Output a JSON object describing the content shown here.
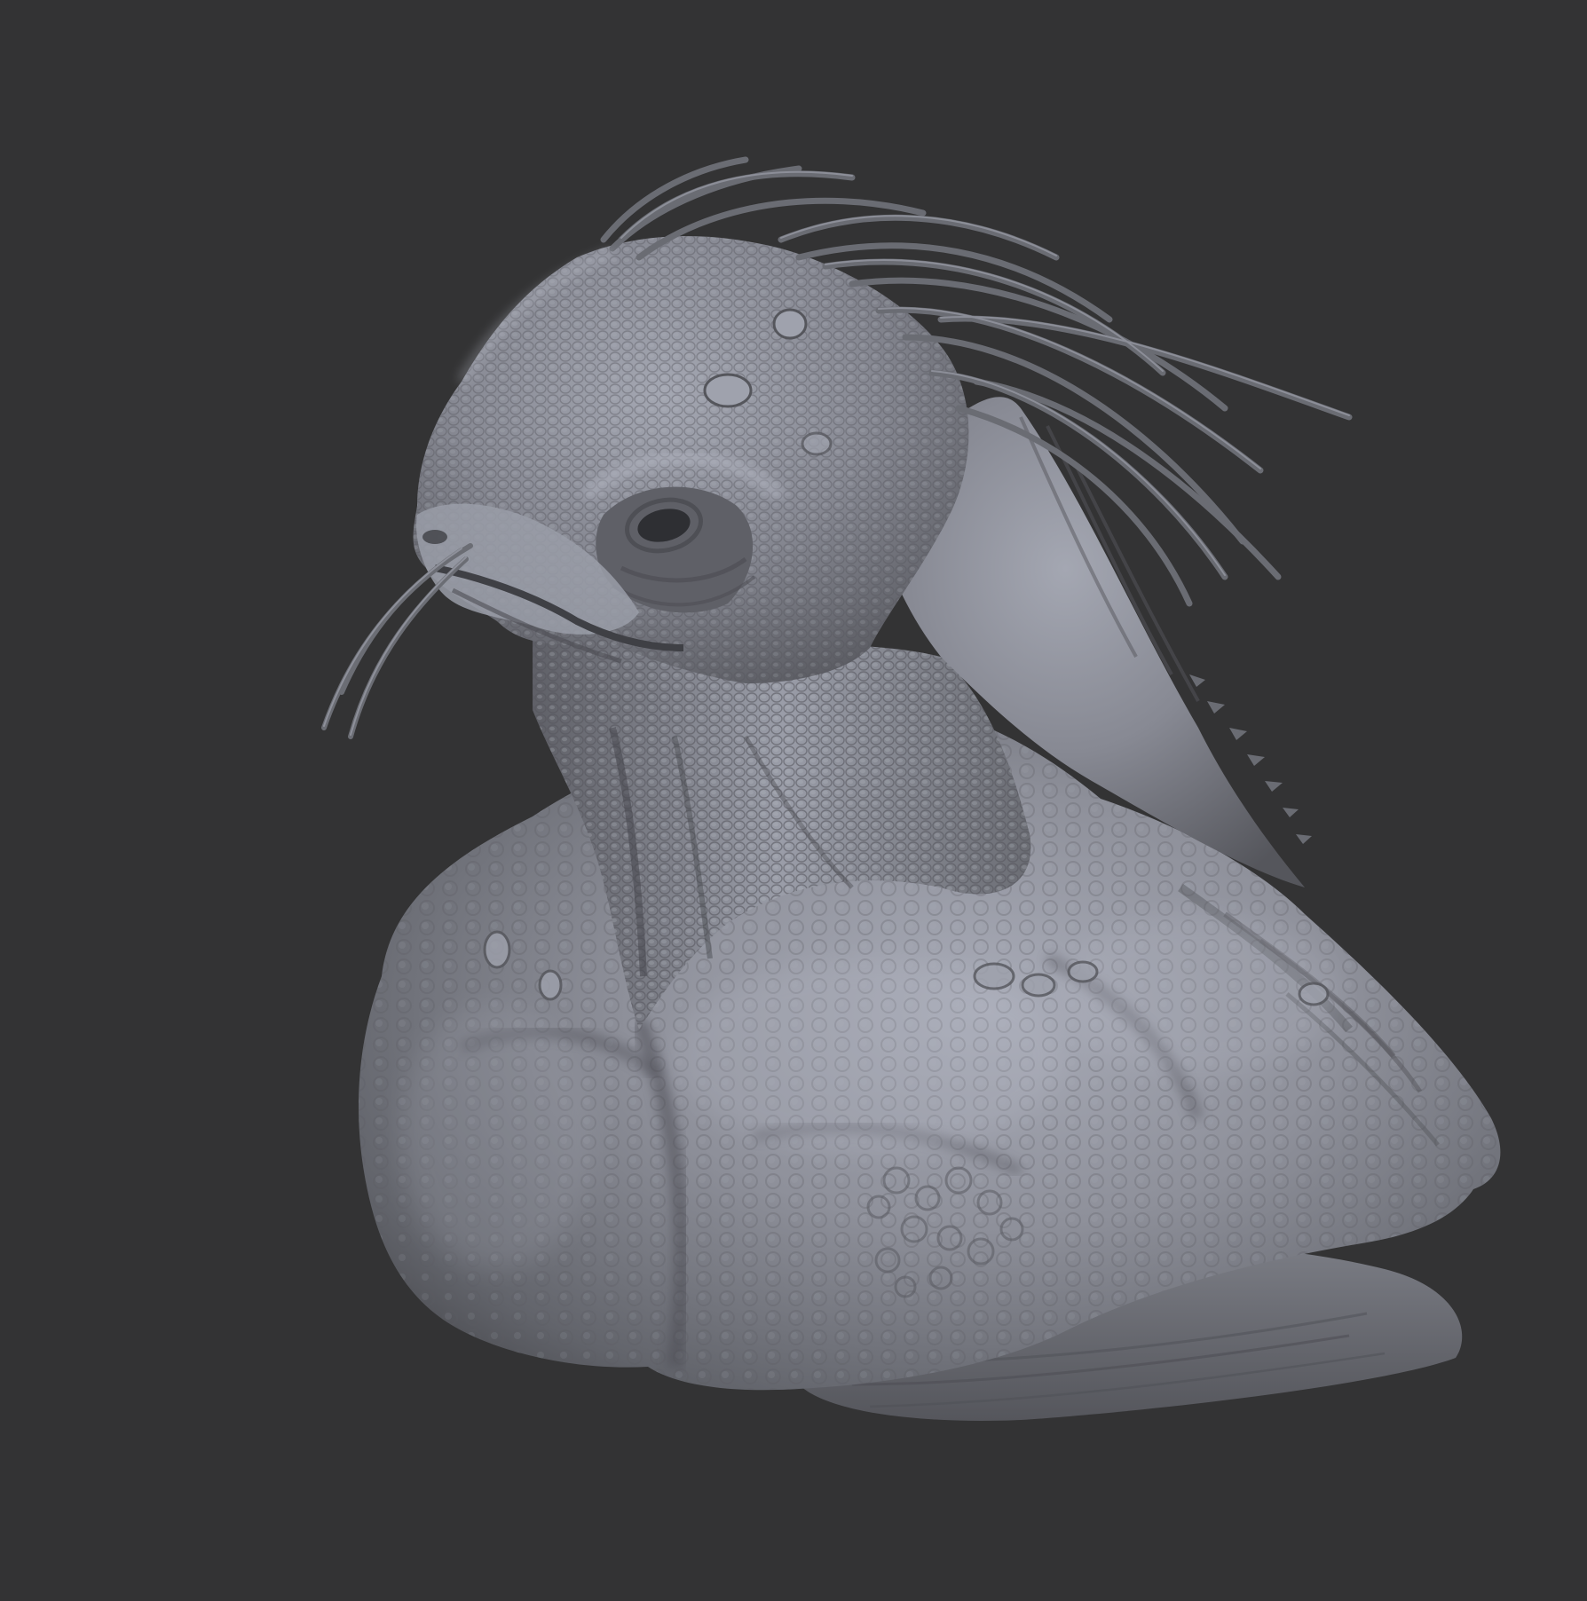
{
  "scene": {
    "background_color": "#333334",
    "surface_color": "#8a8c94",
    "surface_highlight": "#b3b6c2",
    "surface_shadow": "#3a3b40",
    "subject": "creature-bust-sculpt"
  }
}
